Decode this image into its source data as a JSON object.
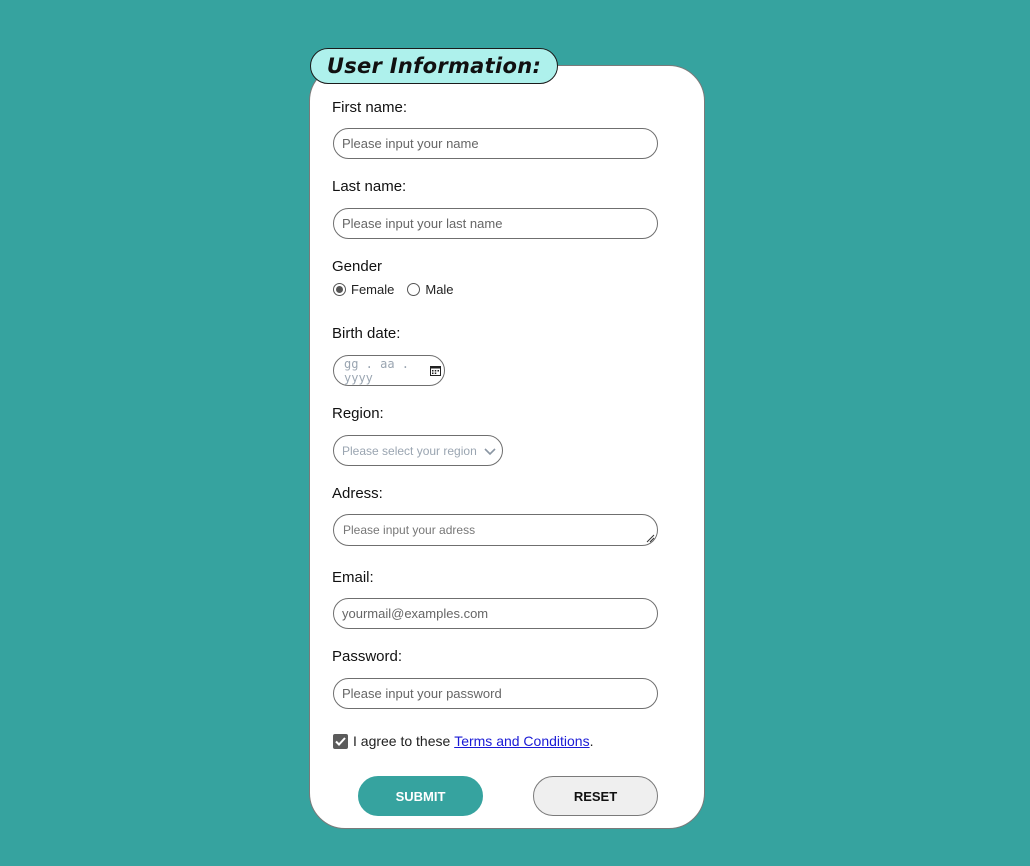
{
  "form": {
    "title": "User Information:",
    "first_name": {
      "label": "First name:",
      "placeholder": "Please input your name"
    },
    "last_name": {
      "label": "Last name:",
      "placeholder": "Please input your last name"
    },
    "gender": {
      "label": "Gender",
      "options": [
        {
          "label": "Female",
          "selected": true
        },
        {
          "label": "Male",
          "selected": false
        }
      ]
    },
    "birth_date": {
      "label": "Birth date:",
      "placeholder": "gg . aa . yyyy"
    },
    "region": {
      "label": "Region:",
      "placeholder": "Please select your region"
    },
    "address": {
      "label": "Adress:",
      "placeholder": "Please input your adress"
    },
    "email": {
      "label": "Email:",
      "placeholder": "yourmail@examples.com"
    },
    "password": {
      "label": "Password:",
      "placeholder": "Please input your password"
    },
    "terms": {
      "checked": true,
      "prefix": "I agree to these ",
      "link": "Terms and Conditions",
      "suffix": "."
    },
    "submit_label": "SUBMIT",
    "reset_label": "RESET"
  },
  "colors": {
    "background": "#36a39f",
    "title_tab": "#aef1ec",
    "submit": "#36a39f",
    "link": "#1a1ad6"
  },
  "icons": [
    "calendar-icon",
    "chevron-down-icon",
    "resize-grip-icon",
    "checkmark-icon"
  ]
}
